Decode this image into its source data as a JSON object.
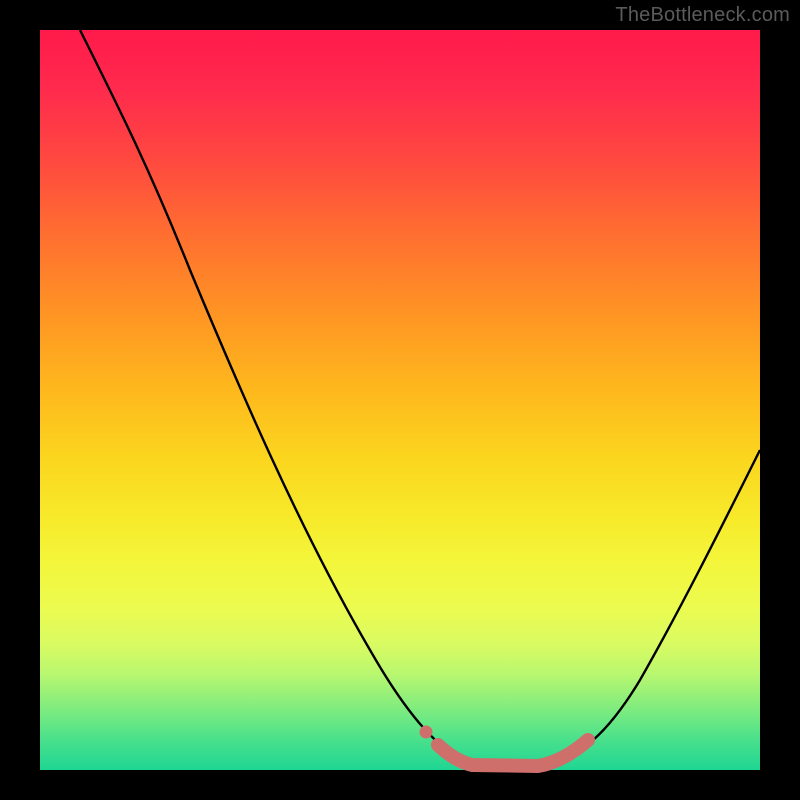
{
  "watermark": "TheBottleneck.com",
  "colors": {
    "background": "#000000",
    "gradient_top": "#ff1a4b",
    "gradient_bottom": "#1fd693",
    "curve": "#000000",
    "marker": "#cf6f6b"
  },
  "chart_data": {
    "type": "line",
    "title": "",
    "xlabel": "",
    "ylabel": "",
    "xlim": [
      0,
      100
    ],
    "ylim": [
      0,
      100
    ],
    "annotations": [],
    "series": [
      {
        "name": "bottleneck-curve",
        "x": [
          0,
          5,
          10,
          15,
          20,
          25,
          30,
          35,
          40,
          45,
          50,
          55,
          58,
          60,
          63,
          65,
          68,
          70,
          73,
          75,
          78,
          80,
          83,
          85,
          88,
          90,
          93,
          95,
          98,
          100
        ],
        "values": [
          100,
          92,
          84,
          76,
          68,
          60,
          52,
          44,
          36,
          28,
          20,
          12,
          7,
          4,
          2,
          1,
          0,
          0,
          0,
          1,
          2,
          4,
          7,
          11,
          16,
          21,
          27,
          33,
          39,
          44
        ]
      },
      {
        "name": "optimal-range-marker",
        "x": [
          58,
          60,
          62,
          64,
          66,
          68,
          70,
          72,
          74,
          76,
          78
        ],
        "values": [
          3,
          2,
          1,
          0.5,
          0,
          0,
          0,
          0.5,
          1,
          2,
          3
        ]
      }
    ]
  }
}
